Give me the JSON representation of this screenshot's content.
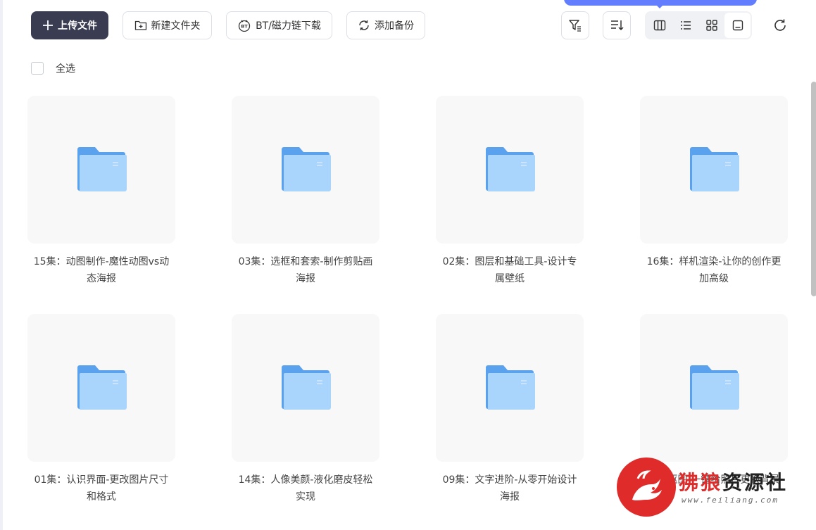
{
  "toolbar": {
    "upload_label": "上传文件",
    "new_folder_label": "新建文件夹",
    "bt_label": "BT/磁力链下载",
    "backup_label": "添加备份"
  },
  "select_all_label": "全选",
  "colors": {
    "primary": "#3a3d52",
    "accent": "#637dff",
    "folder": "#6aaaf0",
    "watermark_red": "#e02b2b"
  },
  "folders": [
    {
      "title": "15集：动图制作-魔性动图vs动态海报"
    },
    {
      "title": "03集：选框和套索-制作剪贴画海报"
    },
    {
      "title": "02集：图层和基础工具-设计专属壁纸"
    },
    {
      "title": "16集：样机渲染-让你的创作更加高级"
    },
    {
      "title": "01集：认识界面-更改图片尺寸和格式"
    },
    {
      "title": "14集：人像美颜-液化磨皮轻松实现"
    },
    {
      "title": "09集：文字进阶-从零开始设计海报"
    },
    {
      "title": "智能抠图-一键给照片更换背景"
    }
  ],
  "watermark": {
    "brand_red": "狒狼",
    "brand": "资源社",
    "url": "www.feiliang.com"
  }
}
